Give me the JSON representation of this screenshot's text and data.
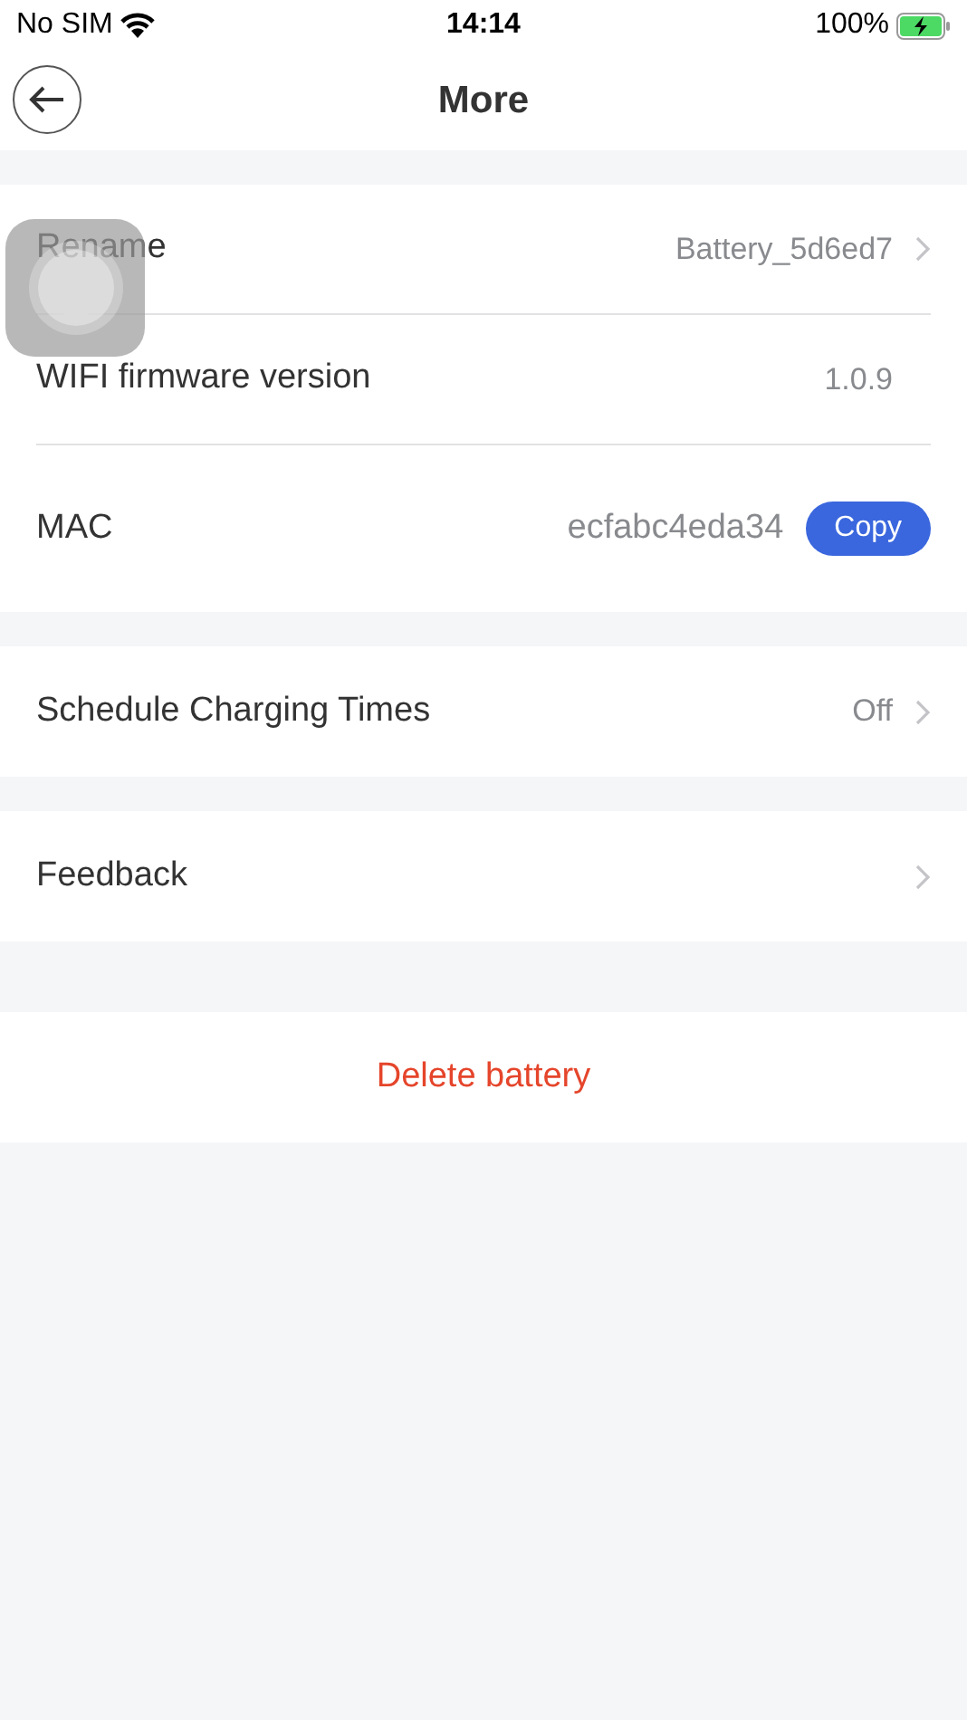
{
  "status_bar": {
    "carrier": "No SIM",
    "time": "14:14",
    "battery": "100%",
    "charging": true
  },
  "nav": {
    "title": "More"
  },
  "groups": [
    {
      "rows": [
        {
          "kind": "link",
          "label": "Rename",
          "value": "Battery_5d6ed7"
        },
        {
          "kind": "value",
          "label": "WIFI firmware version",
          "value": "1.0.9"
        },
        {
          "kind": "copy",
          "label": "MAC",
          "value": "ecfabc4eda34",
          "button": "Copy"
        }
      ]
    },
    {
      "rows": [
        {
          "kind": "link",
          "label": "Schedule Charging Times",
          "value": "Off"
        }
      ]
    },
    {
      "rows": [
        {
          "kind": "link",
          "label": "Feedback"
        }
      ]
    }
  ],
  "delete_button": "Delete battery",
  "assistive_touch": {
    "visible": true
  }
}
